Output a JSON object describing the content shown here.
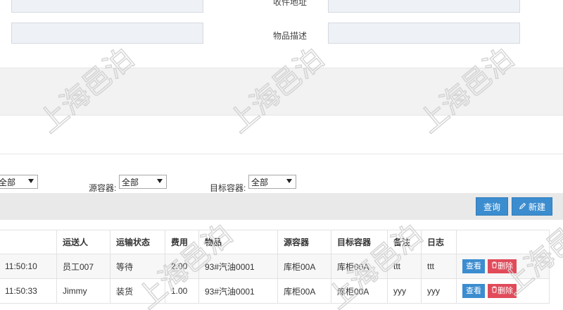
{
  "form": {
    "receiver_address_label": "收件地址",
    "item_description_label": "物品描述"
  },
  "filters": {
    "first_select_value": "全部",
    "source_container_label": "源容器:",
    "source_container_value": "全部",
    "target_container_label": "目标容器:",
    "target_container_value": "全部"
  },
  "toolbar": {
    "query_label": "查询",
    "new_label": "新建"
  },
  "table": {
    "headers": [
      "",
      "运送人",
      "运输状态",
      "费用",
      "物品",
      "源容器",
      "目标容器",
      "备注",
      "日志",
      ""
    ],
    "rows": [
      {
        "time": "11:50:10",
        "courier": "员工007",
        "status": "等待",
        "fee": "2.00",
        "item": "93#汽油0001",
        "source": "库柜00A",
        "target": "库柜00A",
        "note": "ttt",
        "log": "ttt"
      },
      {
        "time": "11:50:33",
        "courier": "Jimmy",
        "status": "装货",
        "fee": "1.00",
        "item": "93#汽油0001",
        "source": "库柜00A",
        "target": "库柜00A",
        "note": "yyy",
        "log": "yyy"
      }
    ],
    "view_label": "查看",
    "delete_label": "删除"
  },
  "watermark": {
    "text": "上海邑泊"
  },
  "icons": {
    "pencil": "pencil-icon",
    "trash": "trash-icon",
    "caret": "caret-down-icon"
  }
}
